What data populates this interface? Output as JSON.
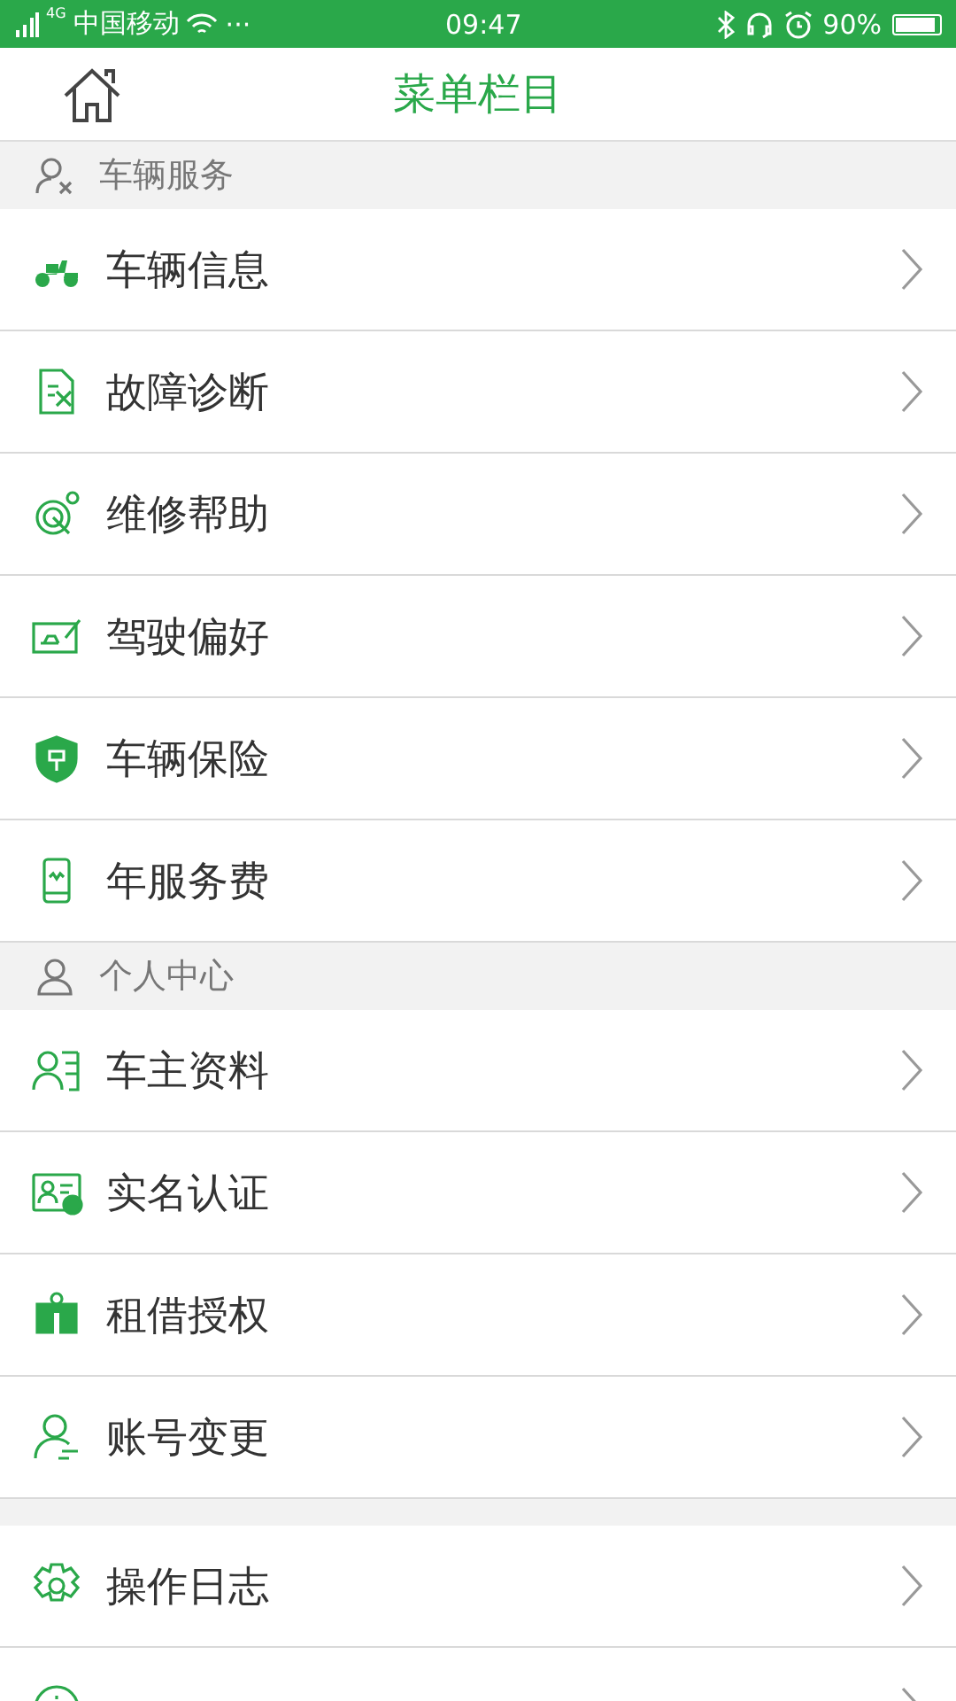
{
  "status_bar": {
    "network": "4G",
    "carrier": "中国移动",
    "dots": "···",
    "time": "09:47",
    "battery": "90%"
  },
  "header": {
    "title": "菜单栏目"
  },
  "sections": [
    {
      "title": "车辆服务",
      "items": [
        {
          "kind": "full",
          "label": "车辆信息"
        },
        {
          "kind": "full",
          "label": "故障诊断"
        },
        {
          "kind": "full",
          "label": "维修帮助"
        },
        {
          "kind": "full",
          "label": "驾驶偏好"
        },
        {
          "kind": "full",
          "label": "车辆保险"
        },
        {
          "kind": "full",
          "label": "年服务费"
        }
      ]
    },
    {
      "title": "个人中心",
      "items": [
        {
          "kind": "full",
          "label": "车主资料"
        },
        {
          "kind": "full",
          "label": "实名认证"
        },
        {
          "kind": "full",
          "label": "租借授权"
        },
        {
          "kind": "full",
          "label": "账号变更"
        }
      ]
    },
    {
      "items": [
        {
          "kind": "full",
          "label": "操作日志"
        },
        {
          "kind": "partial"
        }
      ]
    }
  ]
}
